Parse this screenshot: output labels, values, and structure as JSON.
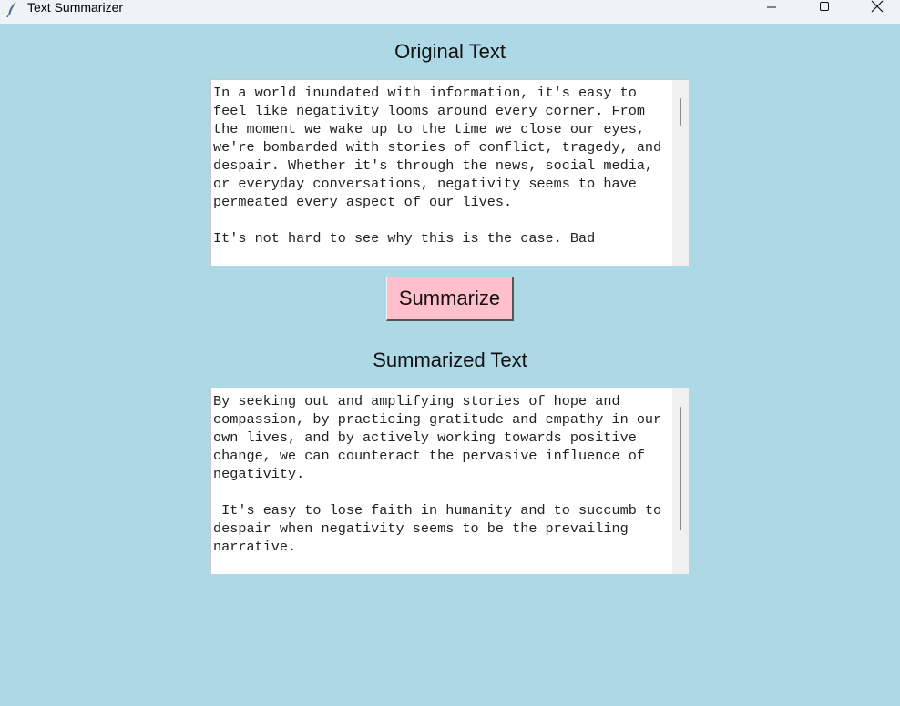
{
  "window": {
    "title": "Text Summarizer",
    "app_icon": "feather-icon",
    "controls": [
      "minimize-icon",
      "maximize-icon",
      "close-icon"
    ]
  },
  "original": {
    "heading": "Original Text",
    "text": "In a world inundated with information, it's easy to feel like negativity looms around every corner. From the moment we wake up to the time we close our eyes, we're bombarded with stories of conflict, tragedy, and despair. Whether it's through the news, social media, or everyday conversations, negativity seems to have permeated every aspect of our lives.\n\nIt's not hard to see why this is the case. Bad"
  },
  "button": {
    "label": "Summarize"
  },
  "summary": {
    "heading": "Summarized Text",
    "text": "By seeking out and amplifying stories of hope and compassion, by practicing gratitude and empathy in our own lives, and by actively working towards positive change, we can counteract the pervasive influence of negativity.\n\n It's easy to lose faith in humanity and to succumb to despair when negativity seems to be the prevailing narrative."
  },
  "colors": {
    "background": "#add8e6",
    "button": "#ffc0cb",
    "titlebar": "#eef3f8"
  }
}
